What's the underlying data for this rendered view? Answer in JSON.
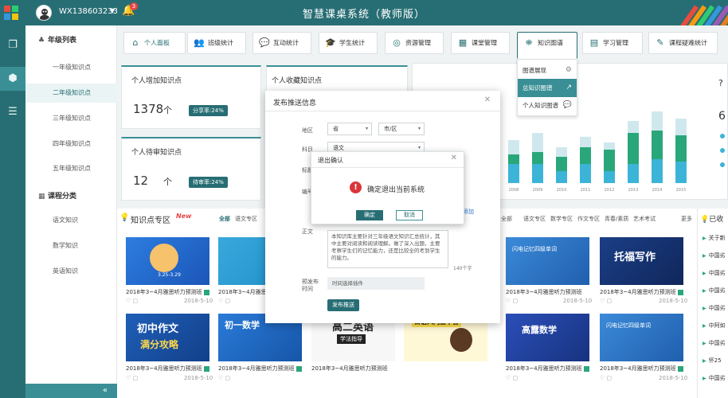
{
  "header": {
    "user_name": "WX138603233",
    "notification_count": "3",
    "app_title": "智慧课桌系统（教师版）"
  },
  "sidebar": {
    "group1_title": "年级列表",
    "grades": [
      "一年级知识点",
      "二年级知识点",
      "三年级知识点",
      "四年级知识点",
      "五年级知识点"
    ],
    "active_grade_index": 1,
    "group2_title": "课程分类",
    "courses": [
      "语文知识",
      "数学知识",
      "英语知识"
    ],
    "collapse_icon": "double-chevron-left-icon"
  },
  "tabs": [
    {
      "label": "个人面板",
      "icon": "home-icon"
    },
    {
      "label": "班级统计",
      "icon": "users-icon"
    },
    {
      "label": "互动统计",
      "icon": "chat-icon"
    },
    {
      "label": "学生统计",
      "icon": "graduation-icon"
    },
    {
      "label": "资源管理",
      "icon": "resource-icon"
    },
    {
      "label": "课堂管理",
      "icon": "calendar-icon"
    },
    {
      "label": "知识图谱",
      "icon": "map-icon"
    },
    {
      "label": "学习管理",
      "icon": "book-icon"
    },
    {
      "label": "课程疑难统计",
      "icon": "edit-icon"
    }
  ],
  "dropdown": [
    {
      "label": "图谱展现",
      "icon": "gear-icon"
    },
    {
      "label": "总知识图谱",
      "icon": "line-chart-icon"
    },
    {
      "label": "个人知识图谱",
      "icon": "message-icon"
    }
  ],
  "stats": {
    "add_title": "个人增加知识点",
    "add_value": "1378",
    "add_unit": "个",
    "add_ratio": "分享率:24%",
    "collect_title": "个人收藏知识点",
    "pending_title": "个人待审知识点",
    "pending_value": "12",
    "pending_unit": "个",
    "pending_ratio": "待审率:24%"
  },
  "chart_data": {
    "type": "bar",
    "categories": [
      "2008",
      "2009",
      "2010",
      "2011",
      "2012",
      "2013",
      "2014",
      "2015"
    ],
    "series": [
      {
        "values": [
          40,
          40,
          25,
          40,
          25,
          40,
          50,
          45
        ],
        "color": "#3cb4d8"
      },
      {
        "values": [
          20,
          25,
          30,
          35,
          45,
          65,
          60,
          55
        ],
        "color": "#2aa77a"
      },
      {
        "values": [
          30,
          40,
          20,
          22,
          15,
          25,
          40,
          35
        ],
        "color": "#cfe8ee"
      }
    ],
    "right_value": "6",
    "right_glyph": "?"
  },
  "kzone": {
    "title": "知识点专区",
    "badge": "New",
    "filters": [
      "全部",
      "语文专区",
      "数学专区",
      "作文专区",
      "青春/素质",
      "艺术考试"
    ],
    "more": "更多",
    "items": [
      {
        "caption": "2018年3~4月雅思听力预测班",
        "date": "2018-5-10"
      },
      {
        "caption": "2018年3~4月雅思听力预测班",
        "date": "2018-5-10"
      },
      {
        "caption": "2018年3~4月雅思听力预测班",
        "date": "2018-5-10"
      },
      {
        "caption": "2018年3~4月雅思听力预测班",
        "date": "2018-5-10"
      },
      {
        "caption": "2018年3~4月雅思听力预测班",
        "date": "2018-5-10"
      },
      {
        "caption": "2018年3~4月雅思听力预测班",
        "date": "2018-5-10"
      }
    ],
    "thumb_texts": [
      "3.25-3.29",
      "高二英语",
      "高露数学",
      "闪电记忆四级单词",
      "托福写作",
      "初中作文",
      "满分攻略",
      "初一数学",
      "日语入门五十音",
      "学法指导"
    ],
    "side_title": "已收",
    "side_items": [
      "关于新",
      "中国劣",
      "中国劣",
      "中国劣",
      "中国劣",
      "中阿如",
      "中国劣",
      "怀25",
      "中国劣"
    ]
  },
  "modal": {
    "title": "发布推送信息",
    "label_region": "地区",
    "province": "省",
    "city": "市/区",
    "label_subject": "科目",
    "subject_value": "语文",
    "label_title": "标题",
    "label_number": "编号",
    "label_body": "正文",
    "body_text": "本知识库主要针对三年级语文知识汇总统计，其中主要对阅读和阅读理解。做了深入出题，主要考察学生们的记忆能力，还是比较全的考到学生的能力。",
    "char_count": "140个字",
    "add_link": "添加",
    "label_publish": "预发布时间",
    "date_placeholder": "时间选择插件",
    "submit": "发布推送"
  },
  "confirm": {
    "title": "退出确认",
    "message": "确定退出当前系统",
    "ok": "确定",
    "cancel": "取消"
  }
}
